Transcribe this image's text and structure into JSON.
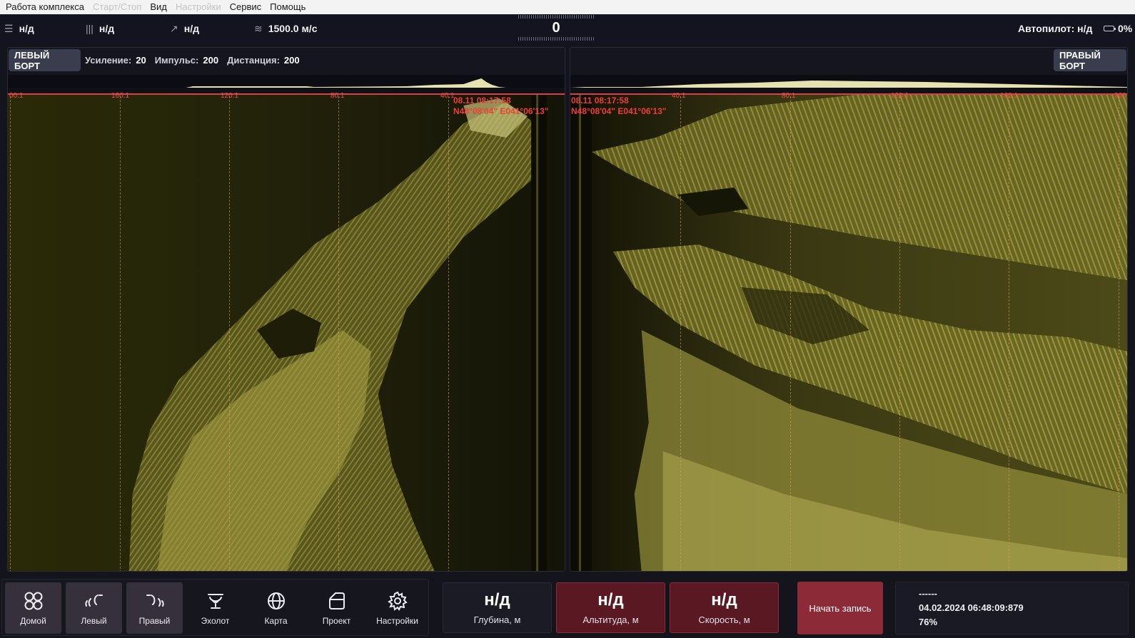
{
  "menu": {
    "items": [
      {
        "label": "Работа комплекса",
        "enabled": true
      },
      {
        "label": "Старт/Стоп",
        "enabled": false
      },
      {
        "label": "Вид",
        "enabled": true
      },
      {
        "label": "Настройки",
        "enabled": false
      },
      {
        "label": "Сервис",
        "enabled": true
      },
      {
        "label": "Помощь",
        "enabled": true
      }
    ]
  },
  "status": {
    "item1": {
      "icon": "menu-lines-icon",
      "value": "н/д"
    },
    "item2": {
      "icon": "bars-icon",
      "value": "н/д"
    },
    "item3": {
      "icon": "arrow-up-right-icon",
      "value": "н/д"
    },
    "item4": {
      "icon": "waves-icon",
      "value": "1500.0 м/с"
    },
    "heading": "0",
    "autopilot": "Автопилот: н/д",
    "battery": "0%"
  },
  "left_panel": {
    "side_label": "ЛЕВЫЙ БОРТ",
    "gain_label": "Усиление:",
    "gain_value": "20",
    "pulse_label": "Импульс:",
    "pulse_value": "200",
    "distance_label": "Дистанция:",
    "distance_value": "200",
    "scale_labels": [
      "00.1",
      "160.1",
      "120.1",
      "80.1",
      "40.1"
    ],
    "stamp_time": "08.11 08:17:58",
    "stamp_coord": "N48°08'04\" E041°06'13\""
  },
  "right_panel": {
    "side_label": "ПРАВЫЙ БОРТ",
    "scale_labels": [
      "40.1",
      "80.1",
      "120.1",
      "160.1",
      "200"
    ],
    "stamp_time": "08.11 08:17:58",
    "stamp_coord": "N48°08'04\" E041°06'13\""
  },
  "toolbar": {
    "buttons": [
      {
        "label": "Домой",
        "icon": "home-grid-icon",
        "active": true
      },
      {
        "label": "Левый",
        "icon": "left-sonar-icon",
        "active": true
      },
      {
        "label": "Правый",
        "icon": "right-sonar-icon",
        "active": true
      },
      {
        "label": "Эхолот",
        "icon": "echosounder-icon",
        "active": false
      },
      {
        "label": "Карта",
        "icon": "globe-icon",
        "active": false
      },
      {
        "label": "Проект",
        "icon": "folder-icon",
        "active": false
      },
      {
        "label": "Настройки",
        "icon": "gear-icon",
        "active": false
      }
    ]
  },
  "metrics": {
    "depth": {
      "value": "н/д",
      "label": "Глубина, м"
    },
    "altitude": {
      "value": "н/д",
      "label": "Альтитуда, м"
    },
    "speed": {
      "value": "н/д",
      "label": "Скорость, м"
    }
  },
  "record_button": "Начать запись",
  "info": {
    "line1": "------",
    "datetime": "04.02.2024   06:48:09:879",
    "percent": "76%"
  },
  "colors": {
    "sonar": "#c8c45a",
    "accent_red": "#ef3e36",
    "alert_bg": "#5a1823",
    "record_bg": "#8c2a38"
  }
}
